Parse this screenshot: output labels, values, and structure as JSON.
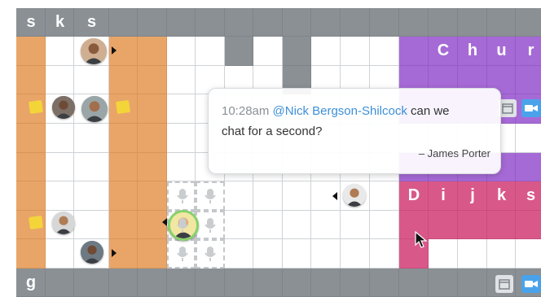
{
  "colors": {
    "gray": "#8a9094",
    "orange": "#e9a568",
    "purple": "#a66ad6",
    "pink": "#d9588a",
    "grid_line": "#cfd3d6",
    "mention": "#3d8fd6",
    "note": "#f3d53a",
    "calendar_button": "#e0e3e6",
    "video_button": "#4aa3ea"
  },
  "name_tiles": {
    "s_k_s": [
      "s",
      "k",
      "s"
    ],
    "church": [
      "C",
      "h",
      "u",
      "r"
    ],
    "dijks": [
      "D",
      "i",
      "j",
      "k",
      "s"
    ],
    "g": [
      "g"
    ]
  },
  "message": {
    "time": "10:28am",
    "mention": "@Nick Bergson-Shilcock",
    "text_after_mention": "can we",
    "line2": "chat for a second?",
    "signature": "– James Porter"
  },
  "icons": {
    "calendar": "calendar-icon",
    "video": "video-camera-icon",
    "note": "sticky-note-icon",
    "mic": "microphone-icon",
    "cursor": "mouse-pointer-icon"
  }
}
